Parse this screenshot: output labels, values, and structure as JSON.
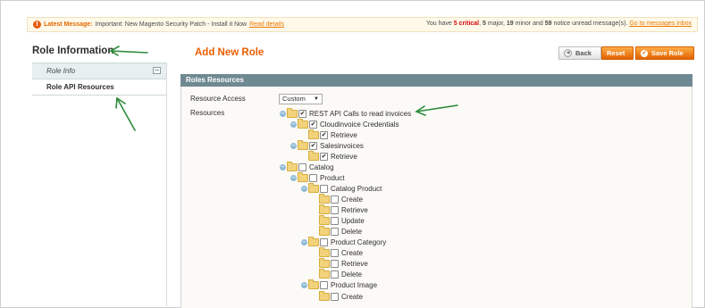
{
  "notification": {
    "label": "Latest Message:",
    "text": "Important: New Magento Security Patch - Install it Now",
    "link": "Read details",
    "summary_prefix": "You have",
    "critical_count": "5 critical",
    "major": "5",
    "major_suffix": "major,",
    "minor": "19",
    "minor_suffix": "minor and",
    "notice": "59",
    "notice_suffix": "notice unread message(s).",
    "inbox_link": "Go to messages inbox",
    "icon": "alert-icon"
  },
  "sidebar": {
    "title": "Role Information",
    "tabs": [
      {
        "label": "Role Info"
      },
      {
        "label": "Role API Resources"
      }
    ]
  },
  "content": {
    "title": "Add New Role",
    "buttons": {
      "back": "Back",
      "reset": "Reset",
      "save": "Save Role"
    }
  },
  "fieldset": {
    "title": "Roles Resources",
    "resource_access_label": "Resource Access",
    "resource_access_value": "Custom",
    "resources_label": "Resources"
  },
  "tree": [
    {
      "label": "REST API Calls to read invoices",
      "checked": true,
      "expanded": true
    },
    {
      "label": "Cloudinvoice Credentials",
      "checked": true,
      "expanded": true
    },
    {
      "label": "Retrieve",
      "checked": true
    },
    {
      "label": "Salesinvoices",
      "checked": true,
      "expanded": true
    },
    {
      "label": "Retrieve",
      "checked": true
    },
    {
      "label": "Catalog",
      "checked": false,
      "expanded": true
    },
    {
      "label": "Product",
      "checked": false,
      "expanded": true
    },
    {
      "label": "Catalog Product",
      "checked": false,
      "expanded": true
    },
    {
      "label": "Create",
      "checked": false
    },
    {
      "label": "Retrieve",
      "checked": false
    },
    {
      "label": "Update",
      "checked": false
    },
    {
      "label": "Delete",
      "checked": false
    },
    {
      "label": "Product Category",
      "checked": false,
      "expanded": true
    },
    {
      "label": "Create",
      "checked": false
    },
    {
      "label": "Retrieve",
      "checked": false
    },
    {
      "label": "Delete",
      "checked": false
    },
    {
      "label": "Product Image",
      "checked": false,
      "expanded": true
    },
    {
      "label": "Create",
      "checked": false
    }
  ],
  "colors": {
    "accent": "#eb5e00",
    "fieldset_header": "#6f8992",
    "annotation": "#2e8b3a"
  }
}
